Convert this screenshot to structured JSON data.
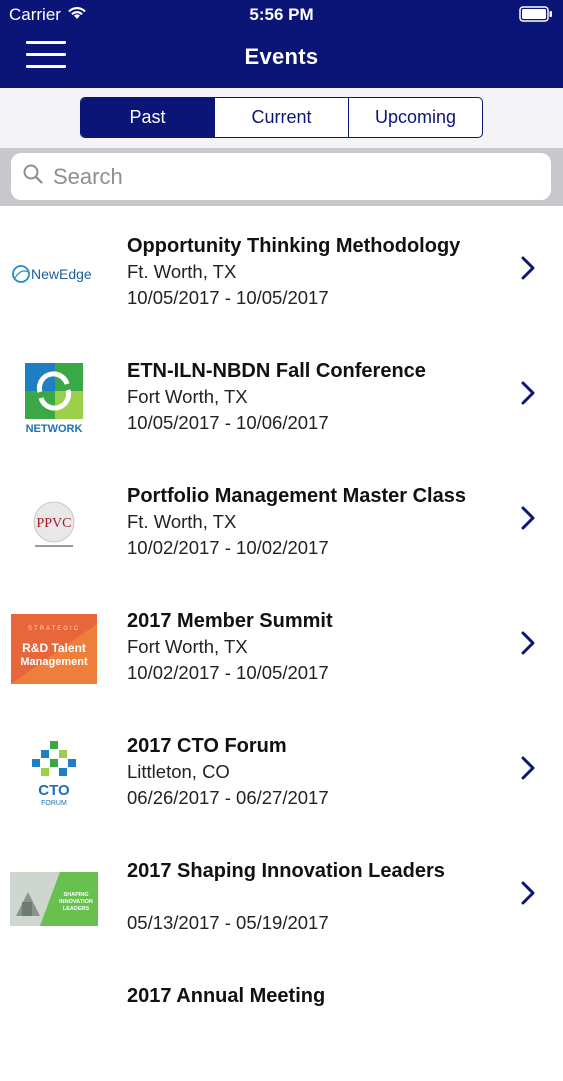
{
  "status": {
    "carrier": "Carrier",
    "time": "5:56 PM"
  },
  "header": {
    "title": "Events"
  },
  "tabs": [
    {
      "label": "Past",
      "active": true
    },
    {
      "label": "Current",
      "active": false
    },
    {
      "label": "Upcoming",
      "active": false
    }
  ],
  "search": {
    "placeholder": "Search",
    "value": ""
  },
  "events": [
    {
      "name": "Opportunity Thinking Methodology",
      "location": "Ft. Worth, TX",
      "dates": "10/05/2017 - 10/05/2017",
      "logo": "newedge-logo",
      "logo_text": "NewEdge"
    },
    {
      "name": "ETN-ILN-NBDN Fall Conference",
      "location": "Fort Worth, TX",
      "dates": "10/05/2017 - 10/06/2017",
      "logo": "network-logo",
      "logo_text": "NETWORK"
    },
    {
      "name": "Portfolio Management Master Class",
      "location": "Ft. Worth, TX",
      "dates": "10/02/2017 - 10/02/2017",
      "logo": "ppvc-logo",
      "logo_text": "PPVC"
    },
    {
      "name": "2017 Member Summit",
      "location": "Fort Worth, TX",
      "dates": "10/02/2017 - 10/05/2017",
      "logo": "rd-talent-logo",
      "logo_text": "R&D Talent Management"
    },
    {
      "name": "2017 CTO Forum",
      "location": "Littleton, CO",
      "dates": "06/26/2017 - 06/27/2017",
      "logo": "cto-forum-logo",
      "logo_text": "CTO"
    },
    {
      "name": "2017 Shaping Innovation Leaders",
      "location": "",
      "dates": "05/13/2017 - 05/19/2017",
      "logo": "shaping-innovation-logo",
      "logo_text": "SHAPING INNOVATION LEADERS"
    },
    {
      "name": "2017 Annual Meeting",
      "location": "",
      "dates": "",
      "logo": "",
      "logo_text": ""
    }
  ],
  "colors": {
    "navy": "#0b1577",
    "search_bg": "#c8c8cc",
    "segment_bg": "#f4f4f6"
  }
}
